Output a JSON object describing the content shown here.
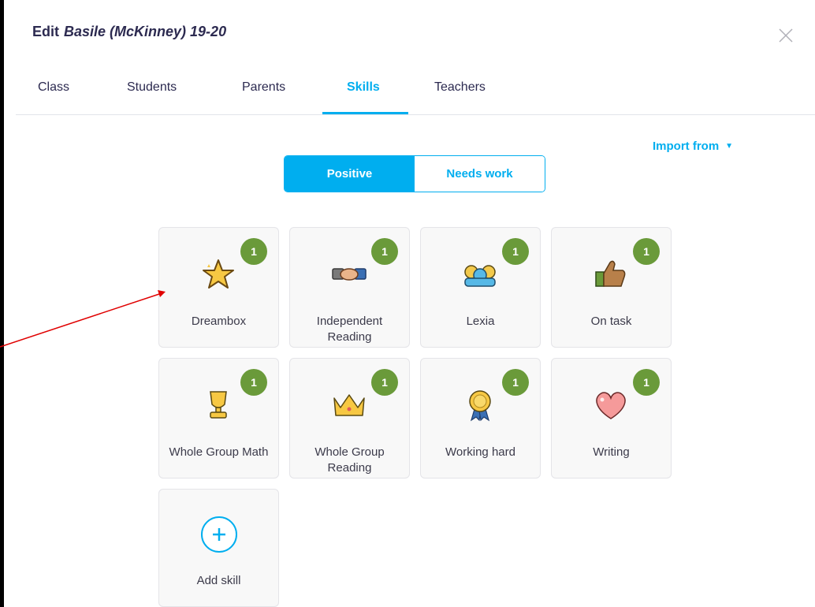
{
  "header": {
    "edit_label": "Edit",
    "class_name": "Basile (McKinney) 19-20",
    "close_icon": "close-icon"
  },
  "tabs": [
    {
      "label": "Class"
    },
    {
      "label": "Students"
    },
    {
      "label": "Parents"
    },
    {
      "label": "Skills",
      "active": true
    },
    {
      "label": "Teachers"
    }
  ],
  "import_from": {
    "label": "Import from",
    "icon": "caret-down-icon"
  },
  "toggle": {
    "positive": "Positive",
    "needs_work": "Needs work",
    "selected": "Positive"
  },
  "skills": [
    {
      "label": "Dreambox",
      "points": "1",
      "icon": "star-icon"
    },
    {
      "label": "Independent Reading",
      "points": "1",
      "icon": "handshake-icon"
    },
    {
      "label": "Lexia",
      "points": "1",
      "icon": "group-icon"
    },
    {
      "label": "On task",
      "points": "1",
      "icon": "thumbs-up-icon"
    },
    {
      "label": "Whole Group Math",
      "points": "1",
      "icon": "trophy-icon"
    },
    {
      "label": "Whole Group Reading",
      "points": "1",
      "icon": "crown-icon"
    },
    {
      "label": "Working hard",
      "points": "1",
      "icon": "medal-icon"
    },
    {
      "label": "Writing",
      "points": "1",
      "icon": "heart-icon"
    }
  ],
  "add_skill": {
    "label": "Add skill",
    "icon": "plus-circle-icon"
  },
  "colors": {
    "accent": "#00aeef",
    "badge": "#6a9a3a",
    "annotation": "#e00000"
  }
}
